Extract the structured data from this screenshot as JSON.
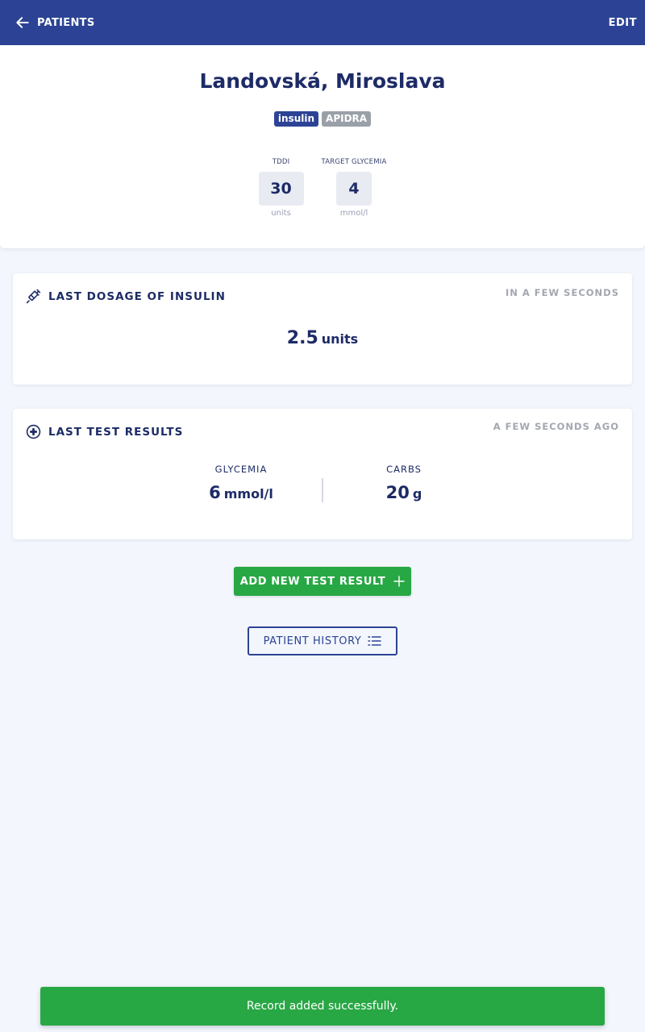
{
  "header": {
    "back_label": "PATIENTS",
    "edit_label": "EDIT",
    "background": "#2c4395"
  },
  "patient": {
    "name": "Landovská, Miroslava",
    "badges": [
      "insulin",
      "APIDRA"
    ],
    "tddi": {
      "label": "TDDI",
      "value": "30",
      "unit": "units"
    },
    "target_glycemia": {
      "label": "TARGET GLYCEMIA",
      "value": "4",
      "unit": "mmol/l"
    }
  },
  "last_dosage": {
    "title": "LAST DOSAGE OF INSULIN",
    "time": "IN A FEW SECONDS",
    "value": "2.5",
    "unit": "units",
    "icon": "syringe-icon"
  },
  "last_results": {
    "title": "LAST TEST RESULTS",
    "time": "A FEW SECONDS AGO",
    "icon": "plus-circle-icon",
    "glycemia": {
      "label": "GLYCEMIA",
      "value": "6",
      "unit": "mmol/l"
    },
    "carbs": {
      "label": "CARBS",
      "value": "20",
      "unit": "g"
    }
  },
  "actions": {
    "add_label": "ADD NEW TEST RESULT",
    "history_label": "PATIENT HISTORY"
  },
  "toast": {
    "message": "Record added successfully."
  },
  "colors": {
    "accent": "#2c4395",
    "success": "#28a745",
    "muted": "#a3a7b0"
  }
}
